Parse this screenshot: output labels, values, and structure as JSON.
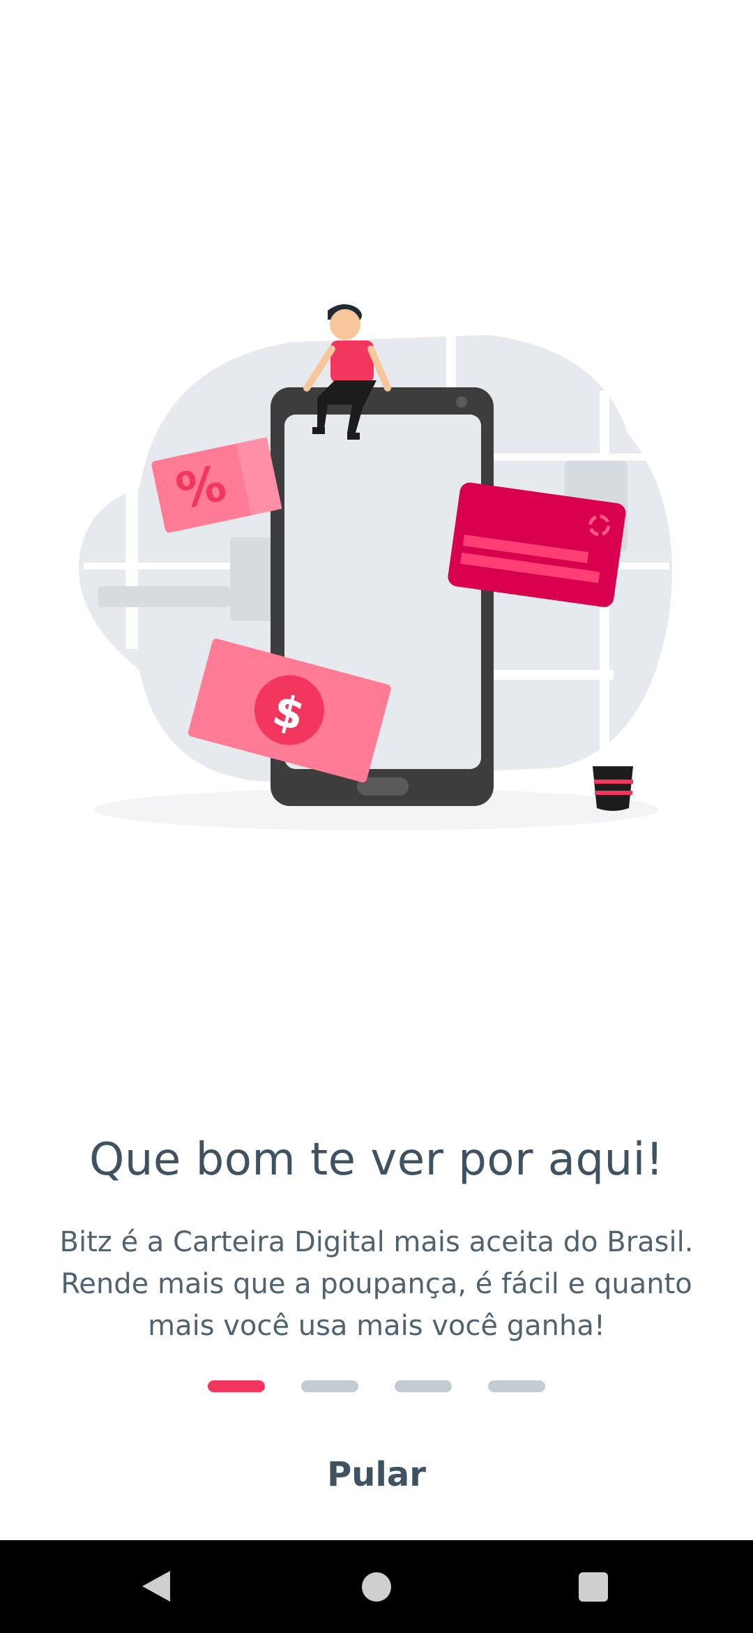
{
  "onboarding": {
    "title": "Que bom te ver por aqui!",
    "description": "Bitz é a Carteira Digital mais aceita do Brasil. Rende mais que a poupança, é fácil e quanto mais você usa mais você ganha!",
    "page_indicator": {
      "total": 4,
      "current": 1
    },
    "skip_label": "Pular"
  },
  "illustration": {
    "name": "digital-wallet-illustration",
    "coupon_symbol": "%",
    "banknote_symbol": "$"
  },
  "navbar": {
    "back_icon": "back-triangle-icon",
    "home_icon": "home-circle-icon",
    "recents_icon": "recents-square-icon"
  },
  "colors": {
    "accent": "#f3365e",
    "text": "#3f5261",
    "indicator_inactive": "#c3ccd3",
    "card": "#d9004d",
    "phone": "#3d3d3d"
  }
}
